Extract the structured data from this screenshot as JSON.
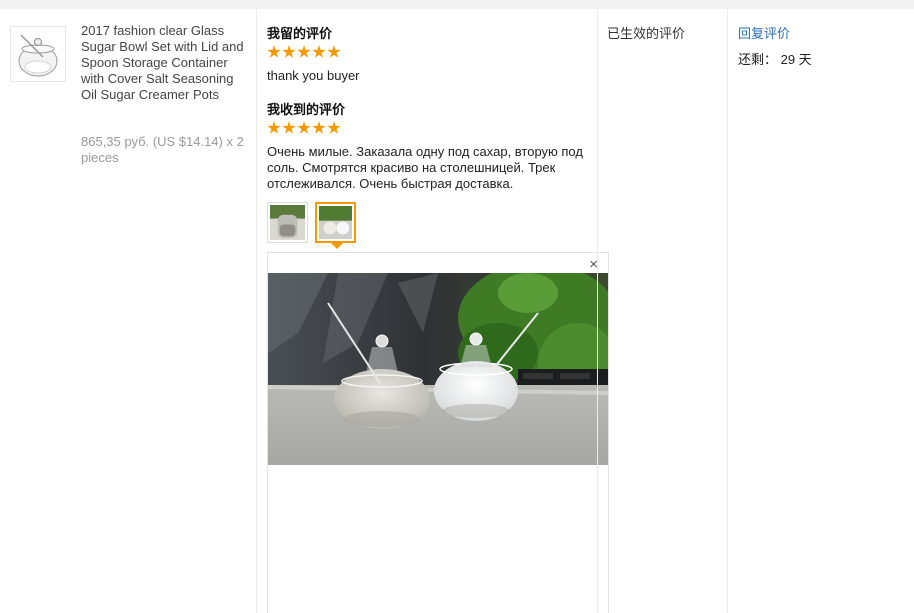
{
  "product": {
    "title": "2017 fashion clear Glass Sugar Bowl Set with Lid and Spoon Storage Container with Cover Salt Seasoning Oil Sugar Creamer Pots",
    "price": "865,35 руб. (US $14.14) x 2 pieces",
    "thumbnail_icon": "glass-jar-image"
  },
  "my_review": {
    "title": "我留的评价",
    "rating": 5,
    "text": "thank you buyer"
  },
  "received_review": {
    "title": "我收到的评价",
    "rating": 5,
    "text": "Очень милые. Заказала одну под сахар, вторую под соль. Смотрятся красиво на столешницей. Трек отслеживался. Очень быстрая доставка.",
    "photos": [
      "photo-1",
      "photo-2"
    ],
    "selected_photo": 1,
    "close_glyph": "×"
  },
  "status": {
    "label": "已生效的评价"
  },
  "action": {
    "reply_label": "回复评价",
    "remaining": "还剩： 29 天"
  },
  "colors": {
    "star": "#f49a00",
    "link": "#2a6db5",
    "muted_text": "#999999"
  }
}
